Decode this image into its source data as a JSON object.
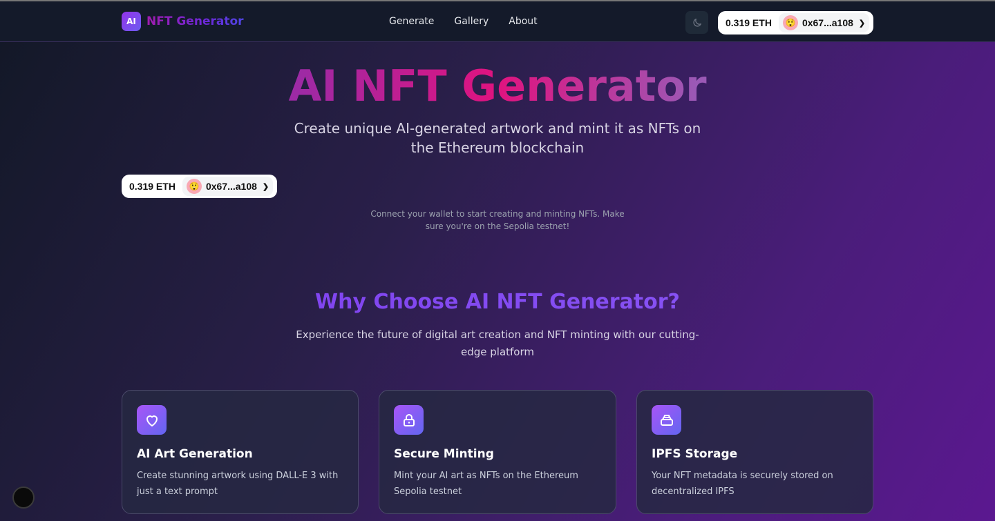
{
  "nav": {
    "brand_logo": "AI",
    "brand_name": "NFT Generator",
    "links": [
      "Generate",
      "Gallery",
      "About"
    ]
  },
  "wallet": {
    "balance": "0.319 ETH",
    "address": "0x67...a108",
    "avatar_emoji": "😲"
  },
  "hero": {
    "title": "AI NFT Generator",
    "subtitle": "Create unique AI-generated artwork and mint it as NFTs on the Ethereum blockchain",
    "connect_note": "Connect your wallet to start creating and minting NFTs. Make sure you're on the Sepolia testnet!"
  },
  "why": {
    "title": "Why Choose AI NFT Generator?",
    "subtitle": "Experience the future of digital art creation and NFT minting with our cutting-edge platform"
  },
  "features": [
    {
      "icon": "heart-icon",
      "title": "AI Art Generation",
      "desc": "Create stunning artwork using DALL-E 3 with just a text prompt"
    },
    {
      "icon": "lock-icon",
      "title": "Secure Minting",
      "desc": "Mint your AI art as NFTs on the Ethereum Sepolia testnet"
    },
    {
      "icon": "storage-icon",
      "title": "IPFS Storage",
      "desc": "Your NFT metadata is securely stored on decentralized IPFS"
    }
  ],
  "colors": {
    "accent_purple": "#7c3aed",
    "accent_pink": "#e0137f",
    "navbar_bg": "#141a2a"
  }
}
